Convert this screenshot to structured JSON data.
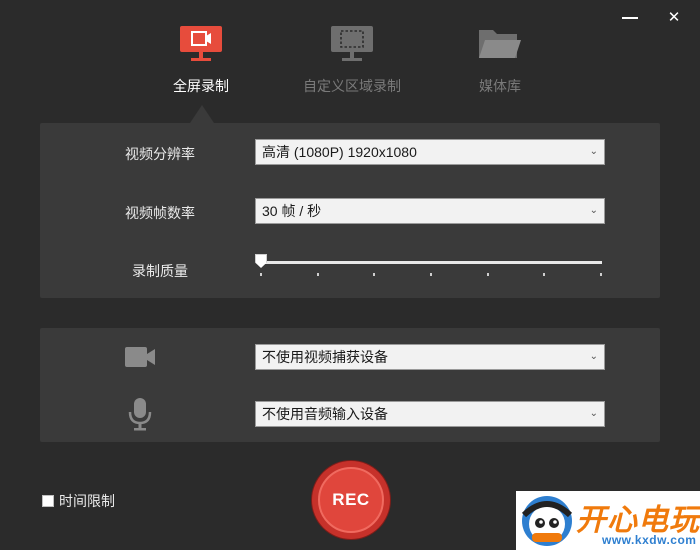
{
  "window": {
    "minimize_icon": "minimize-icon",
    "close_icon": "close-icon",
    "close_glyph": "✕"
  },
  "tabs": [
    {
      "label": "全屏录制",
      "icon": "monitor-fullscreen-icon",
      "active": true,
      "color": "#e74c3c"
    },
    {
      "label": "自定义区域录制",
      "icon": "monitor-region-icon",
      "active": false,
      "color": "#6e6e6e"
    },
    {
      "label": "媒体库",
      "icon": "folder-icon",
      "active": false,
      "color": "#6e6e6e"
    }
  ],
  "settings": {
    "resolution": {
      "label": "视频分辨率",
      "value": "高清 (1080P)   1920x1080"
    },
    "framerate": {
      "label": "视频帧数率",
      "value": "30 帧 / 秒"
    },
    "quality": {
      "label": "录制质量",
      "level": 0,
      "ticks": 7
    }
  },
  "devices": {
    "camera": {
      "icon": "camera-icon",
      "value": "不使用视频捕获设备"
    },
    "microphone": {
      "icon": "microphone-icon",
      "value": "不使用音频输入设备"
    }
  },
  "time_limit": {
    "label": "时间限制",
    "checked": false
  },
  "rec_button": {
    "label": "REC"
  },
  "watermark": {
    "text": "开心电玩",
    "url": "www.kxdw.com"
  },
  "colors": {
    "accent": "#e74c3c",
    "rec": "#e0463c",
    "panel": "#3a3a3a",
    "background": "#2b2b2b"
  }
}
